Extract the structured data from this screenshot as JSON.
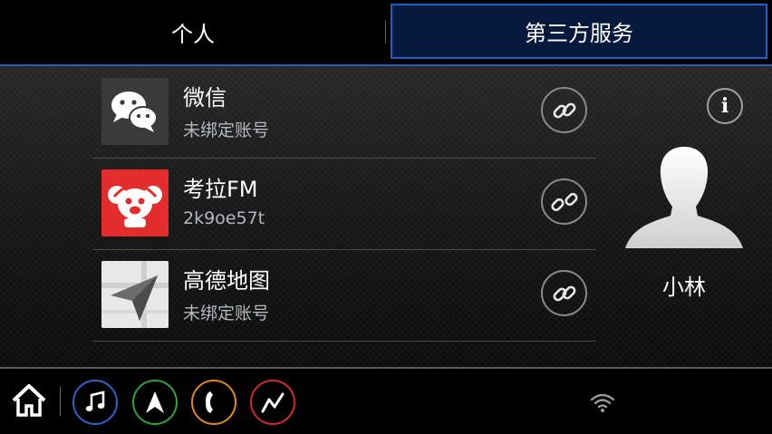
{
  "tabs": {
    "personal_label": "个人",
    "third_party_label": "第三方服务",
    "active": "third_party"
  },
  "services": [
    {
      "name": "微信",
      "account": "未绑定账号",
      "icon": "wechat-icon",
      "icon_color": "#3a3a3a",
      "link_icon": "link-icon"
    },
    {
      "name": "考拉FM",
      "account": "2k9oe57t",
      "icon": "koala-fm-icon",
      "icon_color": "#e32c2c",
      "link_icon": "unlink-icon"
    },
    {
      "name": "高德地图",
      "account": "未绑定账号",
      "icon": "amap-icon",
      "icon_color": "#e6e6e6",
      "link_icon": "link-icon"
    }
  ],
  "user": {
    "name": "小林",
    "avatar_icon": "user-silhouette-icon",
    "info_label": "i"
  },
  "bottom_bar": {
    "home_icon": "home-icon",
    "buttons": [
      {
        "name": "music-icon",
        "color": "#2d63c8"
      },
      {
        "name": "navigation-icon",
        "color": "#2fa238"
      },
      {
        "name": "phone-icon",
        "color": "#e08a1c"
      },
      {
        "name": "seat-icon",
        "color": "#d42a2a"
      }
    ],
    "status_icon": "wifi-icon"
  },
  "colors": {
    "accent": "#1f5fc4",
    "active_tab_bg": "#061a3e",
    "secondary_text": "#b5b8bf"
  }
}
